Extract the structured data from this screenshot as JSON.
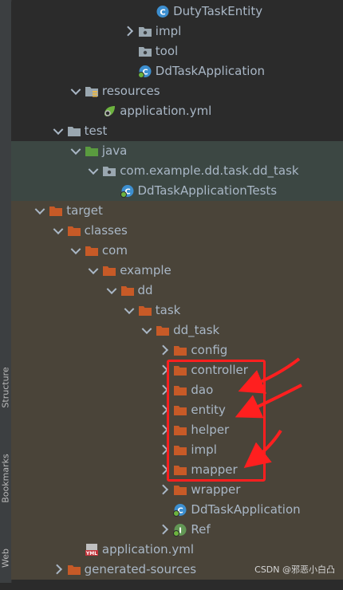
{
  "sidebar": {
    "structure_label": "Structure",
    "bookmarks_label": "Bookmarks",
    "web_label": "Web"
  },
  "tree": [
    {
      "label": "DutyTaskEntity",
      "indent": 7,
      "icon": "java-class-icon",
      "chevron": "none",
      "bg": "plain"
    },
    {
      "label": "impl",
      "indent": 6,
      "icon": "package-icon",
      "chevron": "right",
      "bg": "plain"
    },
    {
      "label": "tool",
      "indent": 6,
      "icon": "package-icon",
      "chevron": "none",
      "bg": "plain"
    },
    {
      "label": "DdTaskApplication",
      "indent": 6,
      "icon": "spring-class-icon",
      "chevron": "none",
      "bg": "plain"
    },
    {
      "label": "resources",
      "indent": 3,
      "icon": "resources-folder-icon",
      "chevron": "down",
      "bg": "plain"
    },
    {
      "label": "application.yml",
      "indent": 4,
      "icon": "spring-config-icon",
      "chevron": "none",
      "bg": "plain"
    },
    {
      "label": "test",
      "indent": 2,
      "icon": "gray-folder-icon",
      "chevron": "down",
      "bg": "plain"
    },
    {
      "label": "java",
      "indent": 3,
      "icon": "test-root-folder-icon",
      "chevron": "down",
      "bg": "test"
    },
    {
      "label": "com.example.dd.task.dd_task",
      "indent": 4,
      "icon": "package-icon",
      "chevron": "down",
      "bg": "test"
    },
    {
      "label": "DdTaskApplicationTests",
      "indent": 5,
      "icon": "spring-class-icon",
      "chevron": "none",
      "bg": "test"
    },
    {
      "label": "target",
      "indent": 1,
      "icon": "orange-folder-icon",
      "chevron": "down",
      "bg": "target"
    },
    {
      "label": "classes",
      "indent": 2,
      "icon": "orange-folder-icon",
      "chevron": "down",
      "bg": "target"
    },
    {
      "label": "com",
      "indent": 3,
      "icon": "orange-folder-icon",
      "chevron": "down",
      "bg": "target"
    },
    {
      "label": "example",
      "indent": 4,
      "icon": "orange-folder-icon",
      "chevron": "down",
      "bg": "target"
    },
    {
      "label": "dd",
      "indent": 5,
      "icon": "orange-folder-icon",
      "chevron": "down",
      "bg": "target"
    },
    {
      "label": "task",
      "indent": 6,
      "icon": "orange-folder-icon",
      "chevron": "down",
      "bg": "target"
    },
    {
      "label": "dd_task",
      "indent": 7,
      "icon": "orange-folder-icon",
      "chevron": "down",
      "bg": "target"
    },
    {
      "label": "config",
      "indent": 8,
      "icon": "orange-folder-icon",
      "chevron": "right",
      "bg": "target"
    },
    {
      "label": "controller",
      "indent": 8,
      "icon": "orange-folder-icon",
      "chevron": "right",
      "bg": "target"
    },
    {
      "label": "dao",
      "indent": 8,
      "icon": "orange-folder-icon",
      "chevron": "right",
      "bg": "target"
    },
    {
      "label": "entity",
      "indent": 8,
      "icon": "orange-folder-icon",
      "chevron": "right",
      "bg": "target"
    },
    {
      "label": "helper",
      "indent": 8,
      "icon": "orange-folder-icon",
      "chevron": "right",
      "bg": "target"
    },
    {
      "label": "impl",
      "indent": 8,
      "icon": "orange-folder-icon",
      "chevron": "right",
      "bg": "target"
    },
    {
      "label": "mapper",
      "indent": 8,
      "icon": "orange-folder-icon",
      "chevron": "right",
      "bg": "target"
    },
    {
      "label": "wrapper",
      "indent": 8,
      "icon": "orange-folder-icon",
      "chevron": "right",
      "bg": "target"
    },
    {
      "label": "DdTaskApplication",
      "indent": 8,
      "icon": "spring-class-icon",
      "chevron": "none",
      "bg": "target"
    },
    {
      "label": "Ref",
      "indent": 8,
      "icon": "interface-icon",
      "chevron": "right",
      "bg": "target"
    },
    {
      "label": "application.yml",
      "indent": 3,
      "icon": "yml-file-icon",
      "chevron": "none",
      "bg": "target"
    },
    {
      "label": "generated-sources",
      "indent": 2,
      "icon": "orange-folder-icon",
      "chevron": "right",
      "bg": "target"
    }
  ],
  "colors": {
    "accent_red": "#ff1f1f",
    "folder_orange": "#c75a27",
    "test_folder_green": "#5a9b3f",
    "class_blue": "#3d8fd0"
  },
  "watermark": "CSDN @邪恶小白凸"
}
